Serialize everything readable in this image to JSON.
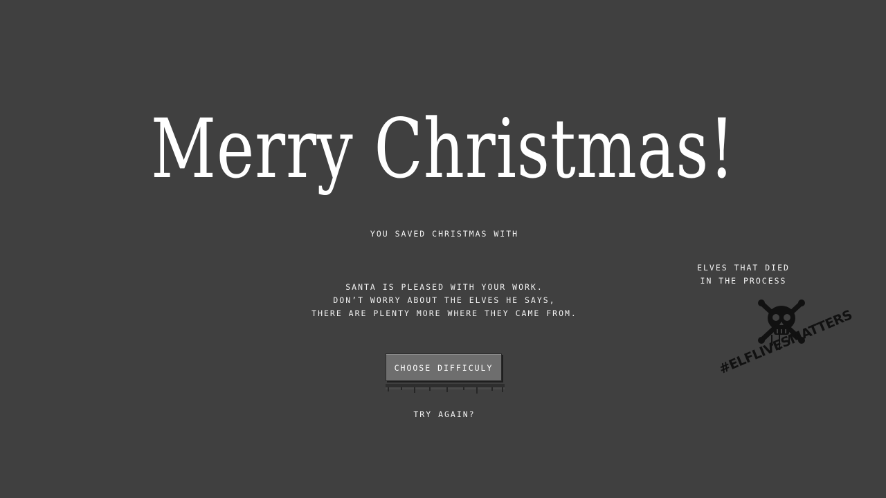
{
  "screen": {
    "title": "Merry Christmas!",
    "saved_label": "YOU SAVED CHRISTMAS WITH",
    "santa_message": [
      "SANTA IS PLEASED WITH YOUR WORK.",
      "DON’T WORRY ABOUT THE ELVES HE SAYS,",
      "THERE ARE PLENTY MORE WHERE THEY CAME FROM."
    ],
    "choose_button_label": "CHOOSE DIFFICULY",
    "try_again_label": "TRY AGAIN?"
  },
  "elves": {
    "label_line1": "ELVES THAT DIED",
    "label_line2": "IN THE PROCESS",
    "hashtag": "#ELFLIVESMATTERS"
  },
  "icons": {
    "skull": "skull-crossbones-icon"
  },
  "colors": {
    "background": "#404040",
    "text": "#ffffff",
    "button": "#6e6e6e"
  }
}
